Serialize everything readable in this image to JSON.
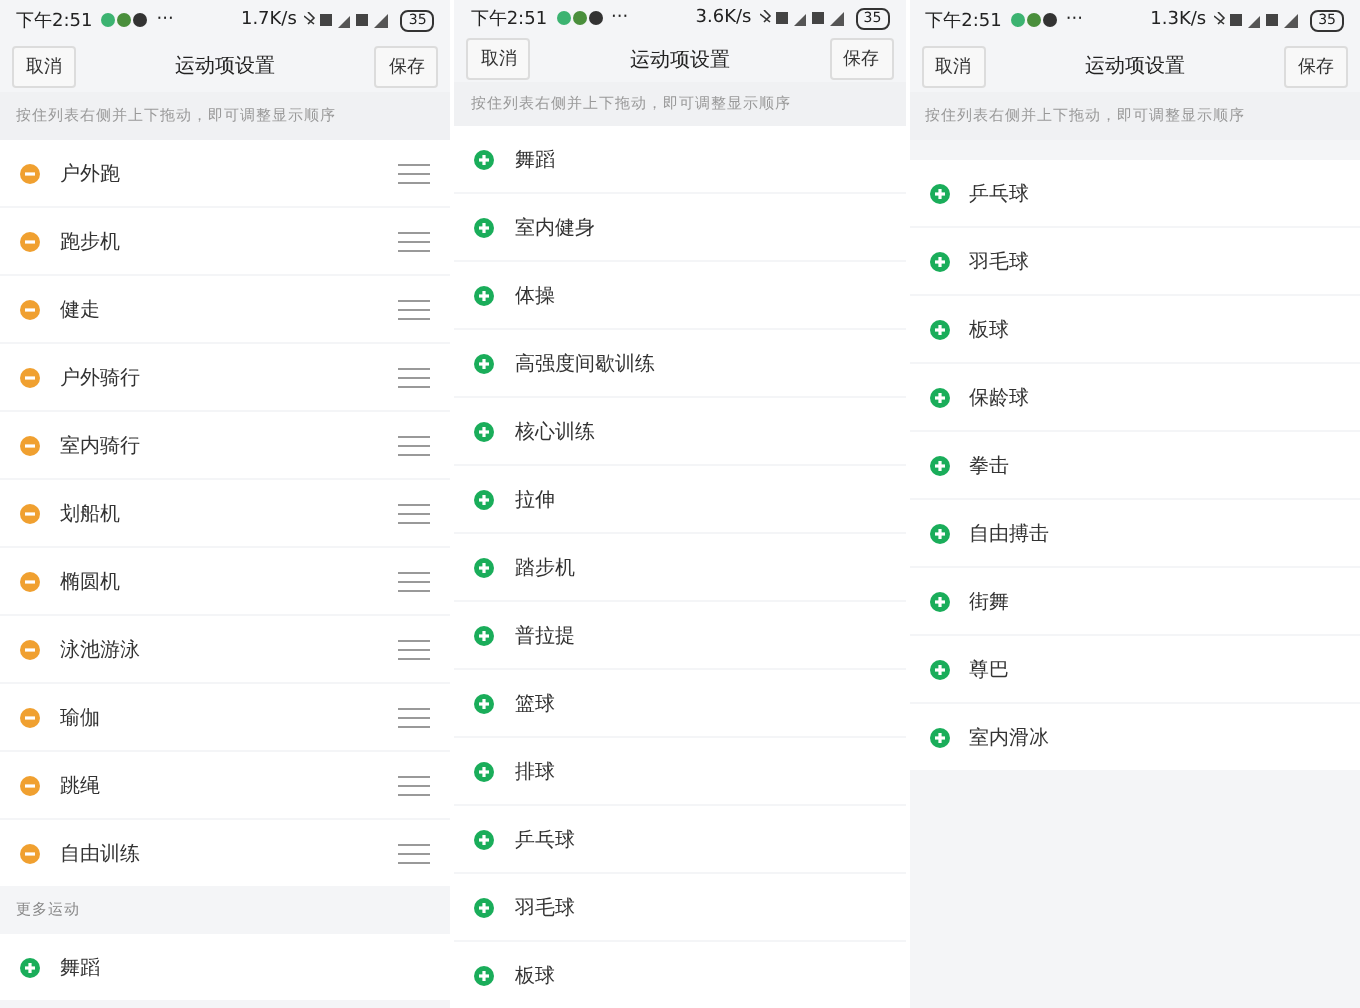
{
  "panels": [
    {
      "status": {
        "time": "下午2:51",
        "more": "···",
        "speed": "1.7K/s",
        "battery": "35"
      },
      "header": {
        "cancel": "取消",
        "title": "运动项设置",
        "save": "保存"
      },
      "hint": "按住列表右侧并上下拖动，即可调整显示顺序",
      "sections": [
        {
          "items": [
            {
              "label": "户外跑",
              "kind": "remove"
            },
            {
              "label": "跑步机",
              "kind": "remove"
            },
            {
              "label": "健走",
              "kind": "remove"
            },
            {
              "label": "户外骑行",
              "kind": "remove"
            },
            {
              "label": "室内骑行",
              "kind": "remove"
            },
            {
              "label": "划船机",
              "kind": "remove"
            },
            {
              "label": "椭圆机",
              "kind": "remove"
            },
            {
              "label": "泳池游泳",
              "kind": "remove"
            },
            {
              "label": "瑜伽",
              "kind": "remove"
            },
            {
              "label": "跳绳",
              "kind": "remove"
            },
            {
              "label": "自由训练",
              "kind": "remove"
            }
          ]
        },
        {
          "heading": "更多运动",
          "items": [
            {
              "label": "舞蹈",
              "kind": "add"
            }
          ]
        }
      ]
    },
    {
      "status": {
        "time": "下午2:51",
        "more": "···",
        "speed": "3.6K/s",
        "battery": "35"
      },
      "header": {
        "cancel": "取消",
        "title": "运动项设置",
        "save": "保存"
      },
      "hint": "按住列表右侧并上下拖动，即可调整显示顺序",
      "sections": [
        {
          "items": [
            {
              "label": "舞蹈",
              "kind": "add"
            },
            {
              "label": "室内健身",
              "kind": "add"
            },
            {
              "label": "体操",
              "kind": "add"
            },
            {
              "label": "高强度间歇训练",
              "kind": "add"
            },
            {
              "label": "核心训练",
              "kind": "add"
            },
            {
              "label": "拉伸",
              "kind": "add"
            },
            {
              "label": "踏步机",
              "kind": "add"
            },
            {
              "label": "普拉提",
              "kind": "add"
            },
            {
              "label": "篮球",
              "kind": "add"
            },
            {
              "label": "排球",
              "kind": "add"
            },
            {
              "label": "乒乓球",
              "kind": "add"
            },
            {
              "label": "羽毛球",
              "kind": "add"
            },
            {
              "label": "板球",
              "kind": "add"
            }
          ]
        }
      ]
    },
    {
      "status": {
        "time": "下午2:51",
        "more": "···",
        "speed": "1.3K/s",
        "battery": "35"
      },
      "header": {
        "cancel": "取消",
        "title": "运动项设置",
        "save": "保存"
      },
      "hint": "按住列表右侧并上下拖动，即可调整显示顺序",
      "sections": [
        {
          "items": [
            {
              "label": "乒乓球",
              "kind": "add"
            },
            {
              "label": "羽毛球",
              "kind": "add"
            },
            {
              "label": "板球",
              "kind": "add"
            },
            {
              "label": "保龄球",
              "kind": "add"
            },
            {
              "label": "拳击",
              "kind": "add"
            },
            {
              "label": "自由搏击",
              "kind": "add"
            },
            {
              "label": "街舞",
              "kind": "add"
            },
            {
              "label": "尊巴",
              "kind": "add"
            },
            {
              "label": "室内滑冰",
              "kind": "add"
            }
          ]
        }
      ]
    }
  ]
}
